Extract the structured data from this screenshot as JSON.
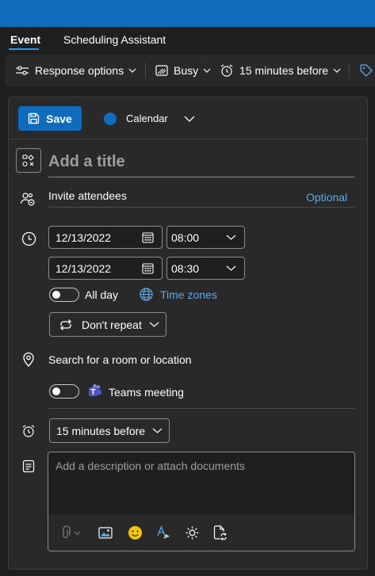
{
  "tabs": [
    {
      "label": "Event",
      "active": true
    },
    {
      "label": "Scheduling Assistant",
      "active": false
    }
  ],
  "toolbar": {
    "response_options": "Response options",
    "show_as": "Busy",
    "reminder": "15 minutes before"
  },
  "header": {
    "save_label": "Save",
    "calendar_label": "Calendar"
  },
  "form": {
    "title_placeholder": "Add a title",
    "attendees_placeholder": "Invite attendees",
    "optional_label": "Optional",
    "start_date": "12/13/2022",
    "start_time": "08:00",
    "end_date": "12/13/2022",
    "end_time": "08:30",
    "all_day_label": "All day",
    "all_day_on": false,
    "time_zones_label": "Time zones",
    "repeat_label": "Don't repeat",
    "location_placeholder": "Search for a room or location",
    "teams_label": "Teams meeting",
    "teams_on": false,
    "reminder_label": "15 minutes before",
    "description_placeholder": "Add a description or attach documents"
  },
  "colors": {
    "accent": "#0f6cbd",
    "link": "#5ca9e5",
    "background": "#1f1f1f",
    "surface": "#292929"
  }
}
